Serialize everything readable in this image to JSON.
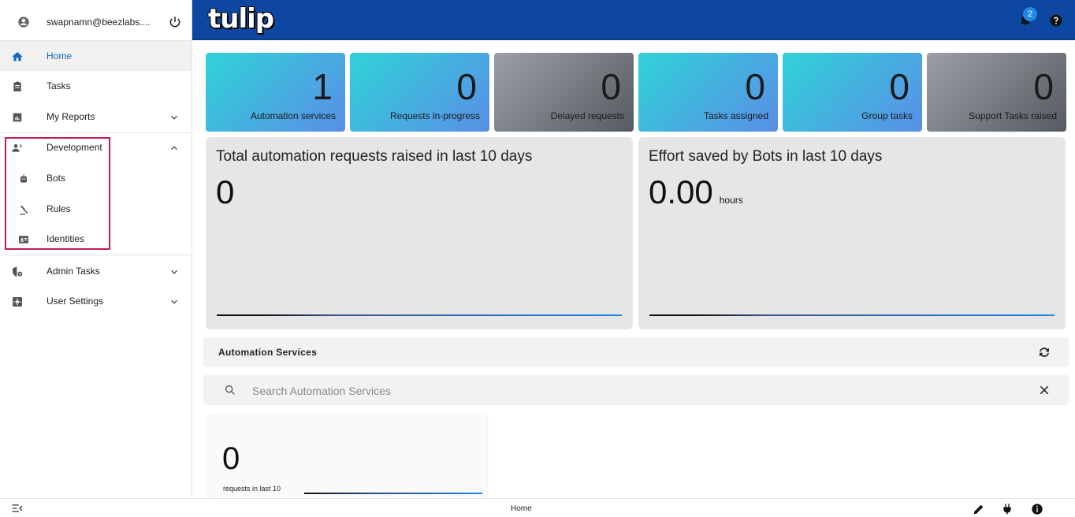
{
  "user": {
    "email": "swapnamn@beezlabs...."
  },
  "sidebar": {
    "items": [
      {
        "label": "Home",
        "icon": "home-icon",
        "active": true
      },
      {
        "label": "Tasks",
        "icon": "clipboard-icon"
      },
      {
        "label": "My Reports",
        "icon": "report-icon"
      },
      {
        "label": "Development",
        "icon": "developer-icon"
      },
      {
        "label": "Bots",
        "icon": "bot-icon"
      },
      {
        "label": "Rules",
        "icon": "gavel-icon"
      },
      {
        "label": "Identities",
        "icon": "id-card-icon"
      },
      {
        "label": "Admin Tasks",
        "icon": "admin-shield-icon"
      },
      {
        "label": "User Settings",
        "icon": "settings-icon"
      }
    ]
  },
  "header": {
    "logo": "tulip",
    "notification_count": "2"
  },
  "stats": [
    {
      "value": "1",
      "label": "Automation services"
    },
    {
      "value": "0",
      "label": "Requests in-progress"
    },
    {
      "value": "0",
      "label": "Delayed requests"
    },
    {
      "value": "0",
      "label": "Tasks assigned"
    },
    {
      "value": "0",
      "label": "Group tasks"
    },
    {
      "value": "0",
      "label": "Support Tasks raised"
    }
  ],
  "panels": {
    "requests": {
      "title": "Total automation requests raised in last 10 days",
      "value": "0"
    },
    "effort": {
      "title": "Effort saved by Bots in last 10 days",
      "value": "0.00",
      "unit": "hours"
    }
  },
  "services": {
    "title": "Automation Services",
    "search_placeholder": "Search Automation Services",
    "card": {
      "value": "0",
      "label": "requests in last 10"
    }
  },
  "footer": {
    "label": "Home"
  },
  "colors": {
    "header": "#0d47a1",
    "accent": "#0f6cbd",
    "highlight": "#c2185b",
    "badge": "#1e88e5"
  }
}
